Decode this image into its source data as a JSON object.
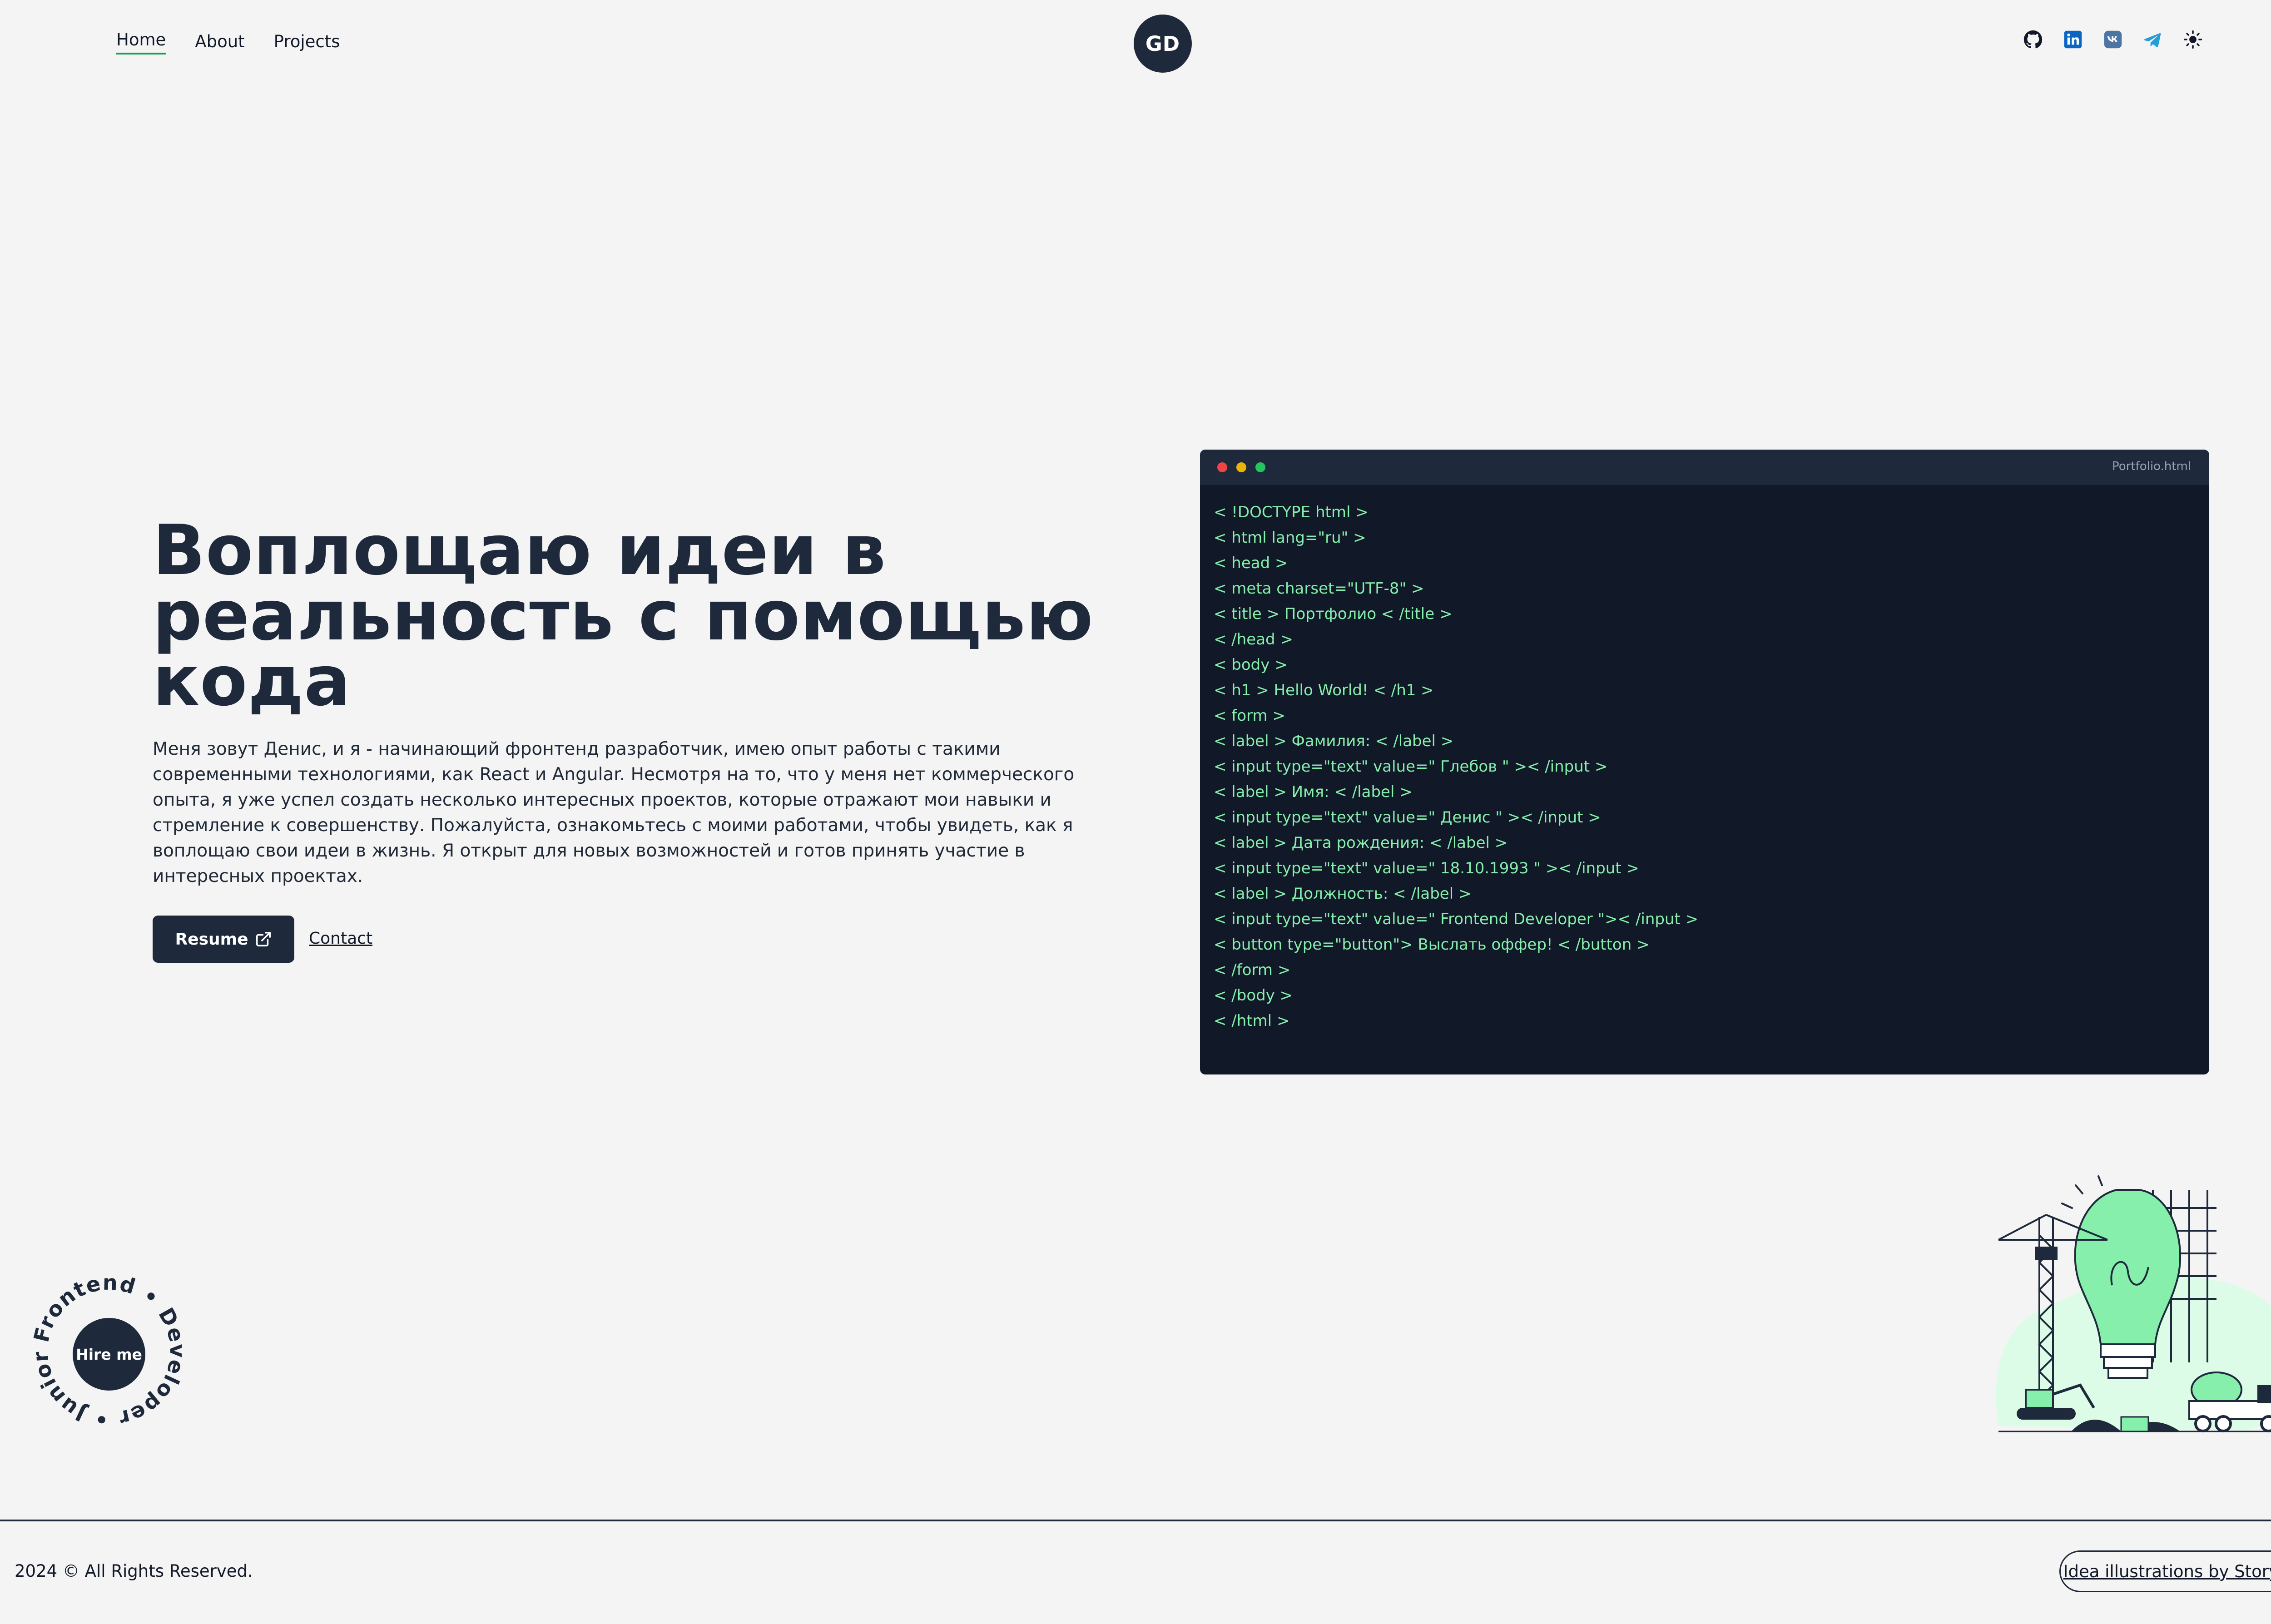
{
  "nav": {
    "items": [
      {
        "label": "Home",
        "active": true
      },
      {
        "label": "About",
        "active": false
      },
      {
        "label": "Projects",
        "active": false
      }
    ]
  },
  "logo": {
    "text": "GD"
  },
  "social": {
    "icons": [
      "github-icon",
      "linkedin-icon",
      "vk-icon",
      "telegram-icon",
      "sun-theme-icon"
    ],
    "colors": {
      "linkedin": "#0a66c2",
      "vk": "#4c75a3",
      "telegram": "#229ed9"
    }
  },
  "hero": {
    "title_lines": [
      "Воплощаю идеи в",
      "реальность с помощью",
      "кода"
    ],
    "description": "Меня зовут Денис, и я - начинающий фронтенд разработчик, имею опыт работы с такими современными технологиями, как React и Angular. Несмотря на то, что у меня нет коммерческого опыта, я уже успел создать несколько интересных проектов, которые отражают мои навыки и стремление к совершенству. Пожалуйста, ознакомьтесь с моими работами, чтобы увидеть, как я воплощаю свои идеи в жизнь. Я открыт для новых возможностей и готов принять участие в интересных проектах.",
    "resume_label": "Resume",
    "contact_label": "Contact"
  },
  "code_window": {
    "filename": "Portfolio.html",
    "dot_colors": [
      "#ef4444",
      "#eab308",
      "#22c55e"
    ],
    "lines": [
      "< !DOCTYPE html >",
      "< html lang=\"ru\" >",
      "< head >",
      "< meta charset=\"UTF-8\" >",
      "< title > Портфолио < /title >",
      "< /head >",
      "< body >",
      "< h1 > Hello World! < /h1 >",
      "< form >",
      "< label > Фамилия: < /label >",
      "< input type=\"text\" value=\" Глебов \" >< /input >",
      "< label > Имя: < /label >",
      "< input type=\"text\" value=\" Денис \" >< /input >",
      "< label > Дата рождения: < /label >",
      "< input type=\"text\" value=\" 18.10.1993 \" >< /input >",
      "< label > Должность: < /label >",
      "< input type=\"text\" value=\" Frontend Developer \">< /input >",
      "< button type=\"button\"> Выслать оффер! < /button >",
      "< /form >",
      "< /body >",
      "< /html >"
    ]
  },
  "badge": {
    "ring_text": "Frontend • Developer • Junior •",
    "button_label": "Hire me"
  },
  "footer": {
    "copyright": "2024 © All Rights Reserved.",
    "credit": "Idea illustrations by Storyset"
  },
  "colors": {
    "dark": "#1e293b",
    "code_bg": "#111827",
    "code_text": "#86efac",
    "accent_green": "#16a34a"
  }
}
